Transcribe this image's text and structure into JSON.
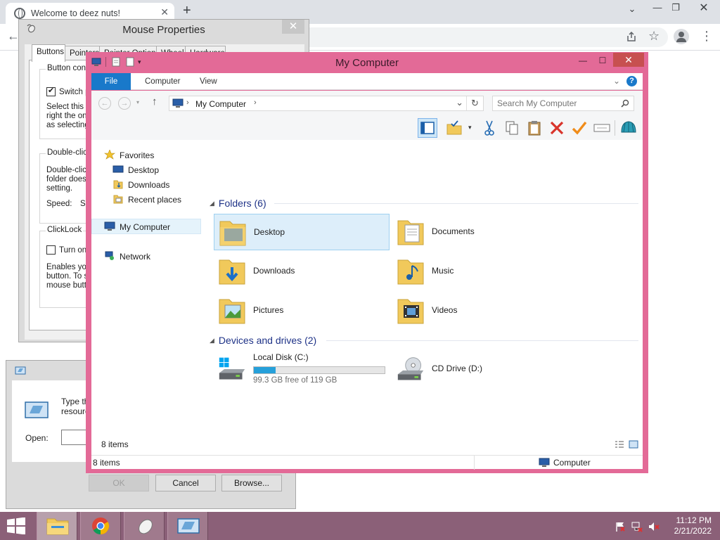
{
  "browser": {
    "tab_title": "Welcome to deez nuts!",
    "tab_close": "✕",
    "new_tab": "+",
    "minimize": "⌄",
    "min2": "—",
    "restore": "❐",
    "close": "✕",
    "back": "←",
    "share_icon": "share-icon",
    "star": "☆",
    "menu": "⋮"
  },
  "mouse_properties": {
    "title": "Mouse Properties",
    "close": "✕",
    "tabs": [
      "Buttons",
      "Pointers",
      "Pointer Options",
      "Wheel",
      "Hardware"
    ],
    "button_config_label": "Button config",
    "switch_label": "Switch pr",
    "switch_checked": true,
    "select_text": [
      "Select this c",
      "right the one",
      "as selecting"
    ],
    "double_click_label": "Double-click",
    "double_click_text": [
      "Double-click",
      "folder does n",
      "setting."
    ],
    "speed_label": "Speed:",
    "speed_value": "Sl",
    "clicklock_label": "ClickLock",
    "turn_on_label": "Turn on C",
    "clicklock_text": [
      "Enables you",
      "button. To s",
      "mouse butto"
    ]
  },
  "run_dialog": {
    "type_text": [
      "Type the",
      "resourc"
    ],
    "open_label": "Open:",
    "ok": "OK",
    "cancel": "Cancel",
    "browse": "Browse..."
  },
  "explorer": {
    "title": "My Computer",
    "min": "—",
    "max": "☐",
    "close": "✕",
    "ribbon_tabs": [
      "File",
      "Computer",
      "View"
    ],
    "chevron": "⌄",
    "help": "?",
    "address_text": "My Computer",
    "address_sep": "›",
    "search_placeholder": "Search My Computer",
    "nav": {
      "favorites": "Favorites",
      "desktop": "Desktop",
      "downloads": "Downloads",
      "recent": "Recent places",
      "my_computer": "My Computer",
      "network": "Network"
    },
    "folders_header": "Folders (6)",
    "folders": [
      "Desktop",
      "Documents",
      "Downloads",
      "Music",
      "Pictures",
      "Videos"
    ],
    "devices_header": "Devices and drives (2)",
    "drive_c": {
      "name": "Local Disk (C:)",
      "free_text": "99.3 GB free of 119 GB",
      "used_fraction": 0.166
    },
    "drive_d": {
      "name": "CD Drive (D:)"
    },
    "item_count": "8 items",
    "status_count": "8 items",
    "status_location": "Computer"
  },
  "taskbar": {
    "time": "11:12 PM",
    "date": "2/21/2022"
  },
  "colors": {
    "accent_window": "#e36a97",
    "file_tab": "#1979ca",
    "taskbar": "#8b6078",
    "drive_fill": "#26a0da"
  }
}
